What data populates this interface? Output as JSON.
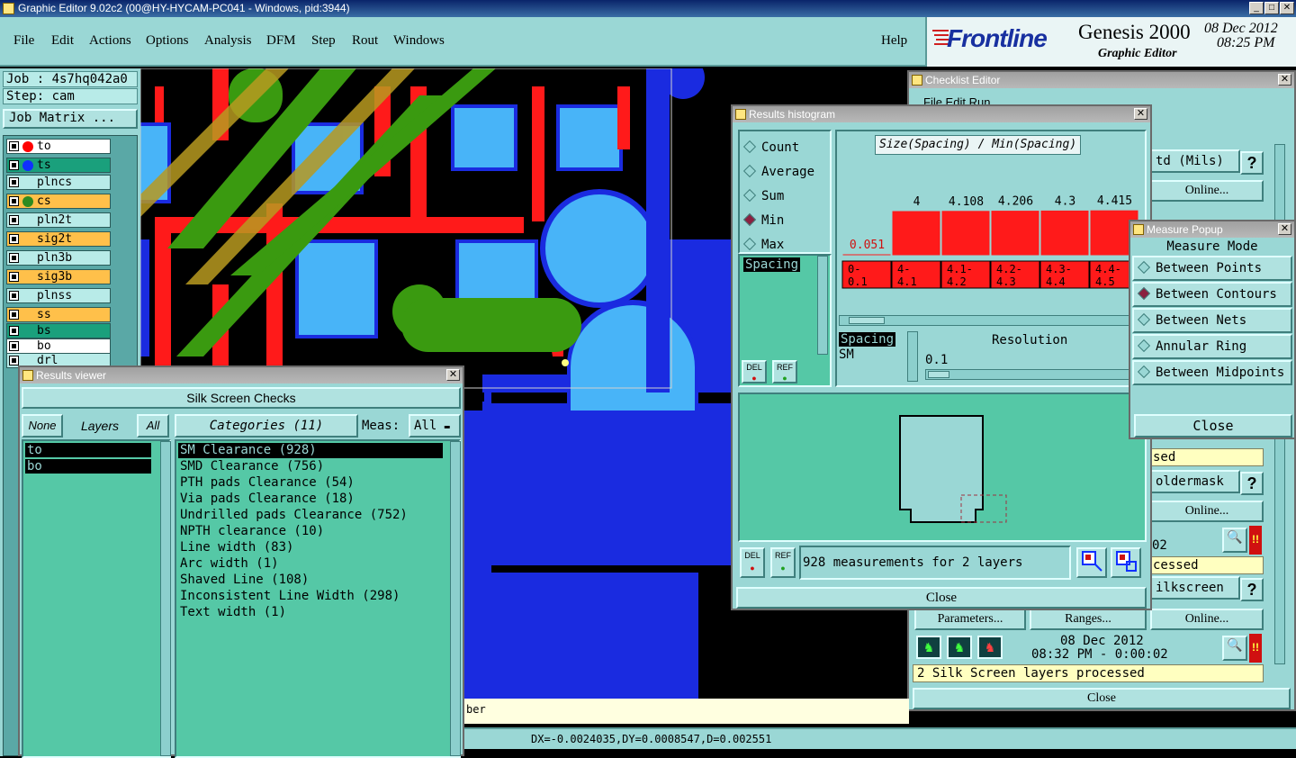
{
  "window": {
    "title": "Graphic Editor 9.02c2 (00@HY-HYCAM-PC041 - Windows, pid:3944)"
  },
  "menu": [
    "File",
    "Edit",
    "Actions",
    "Options",
    "Analysis",
    "DFM",
    "Step",
    "Rout",
    "Windows"
  ],
  "help": "Help",
  "brand": {
    "logo": "Frontline",
    "product": "Genesis 2000",
    "subtitle": "Graphic Editor",
    "date": "08 Dec 2012",
    "time": "08:25 PM"
  },
  "left": {
    "job": "Job : 4s7hq042a0",
    "step": "Step: cam",
    "job_matrix": "Job Matrix ...",
    "layers": [
      {
        "name": "to",
        "bg": "#ffffff",
        "dot": "#ff0000"
      },
      {
        "name": "ts",
        "bg": "#1aa07c",
        "dot": "#1030ff"
      },
      {
        "name": "plncs",
        "bg": "#b8ebe8",
        "dot": ""
      },
      {
        "name": "cs",
        "bg": "#ffc04a",
        "dot": "#2e8b20"
      },
      {
        "name": "pln2t",
        "bg": "#b8ebe8",
        "dot": ""
      },
      {
        "name": "sig2t",
        "bg": "#ffc04a",
        "dot": ""
      },
      {
        "name": "pln3b",
        "bg": "#b8ebe8",
        "dot": ""
      },
      {
        "name": "sig3b",
        "bg": "#ffc04a",
        "dot": ""
      },
      {
        "name": "plnss",
        "bg": "#b8ebe8",
        "dot": ""
      },
      {
        "name": "ss",
        "bg": "#ffc04a",
        "dot": ""
      },
      {
        "name": "bs",
        "bg": "#1aa07c",
        "dot": ""
      },
      {
        "name": "bo",
        "bg": "#ffffff",
        "dot": ""
      },
      {
        "name": "drl",
        "bg": "#b8ebe8",
        "dot": ""
      }
    ]
  },
  "results_viewer": {
    "title": "Results viewer",
    "heading": "Silk Screen Checks",
    "none": "None",
    "layers": "Layers",
    "all": "All",
    "categories": "Categories (11)",
    "meas_label": "Meas:",
    "meas_value": "All",
    "layer_list": [
      "to",
      "bo"
    ],
    "items": [
      "SM Clearance (928)",
      "SMD Clearance (756)",
      "PTH pads Clearance (54)",
      "Via pads Clearance (18)",
      "Undrilled pads Clearance (752)",
      "NPTH clearance (10)",
      "Line width (83)",
      "Arc width (1)",
      "Shaved Line (108)",
      "Inconsistent Line Width (298)",
      "Text width (1)"
    ]
  },
  "histogram": {
    "title": "Results histogram",
    "modes": [
      "Count",
      "Average",
      "Sum",
      "Min",
      "Max"
    ],
    "selected_mode": "Min",
    "chart_title": "Size(Spacing) / Min(Spacing)",
    "spacing_list": "Spacing",
    "spacing2": "Spacing",
    "sm": "SM",
    "resolution": "Resolution",
    "resolution_value": "0.1",
    "bins": [
      "0-\n 0.1",
      "4-\n 4.1",
      "4.1-\n 4.2",
      "4.2-\n 4.3",
      "4.3-\n 4.4",
      "4.4-\n 4.5"
    ],
    "values": [
      "0.051",
      "4",
      "4.108",
      "4.206",
      "4.3",
      "4.415"
    ],
    "del": "DEL",
    "ref": "REF",
    "summary": "928 measurements for 2 layers",
    "close": "Close"
  },
  "checklist": {
    "title": "Checklist Editor",
    "menu": "File   Edit   Run",
    "units": "td (Mils)",
    "online": "Online...",
    "sed": "sed",
    "soldermask": "oldermask",
    "n02": "02",
    "cessed": "cessed",
    "silkscreen": "ilkscreen",
    "parameters": "Parameters...",
    "ranges": "Ranges...",
    "date": "08 Dec 2012",
    "time": "08:32 PM - 0:00:02",
    "processed": "2 Silk Screen layers processed",
    "close": "Close",
    "q": "?"
  },
  "measure": {
    "title": "Measure Popup",
    "mode_title": "Measure Mode",
    "options": [
      "Between Points",
      "Between Contours",
      "Between Nets",
      "Annular Ring",
      "Between Midpoints"
    ],
    "selected": "Between Contours",
    "close": "Close"
  },
  "status": {
    "coords": "DX=-0.0024035,DY=0.0008547,D=0.002551",
    "ber": "ber"
  }
}
